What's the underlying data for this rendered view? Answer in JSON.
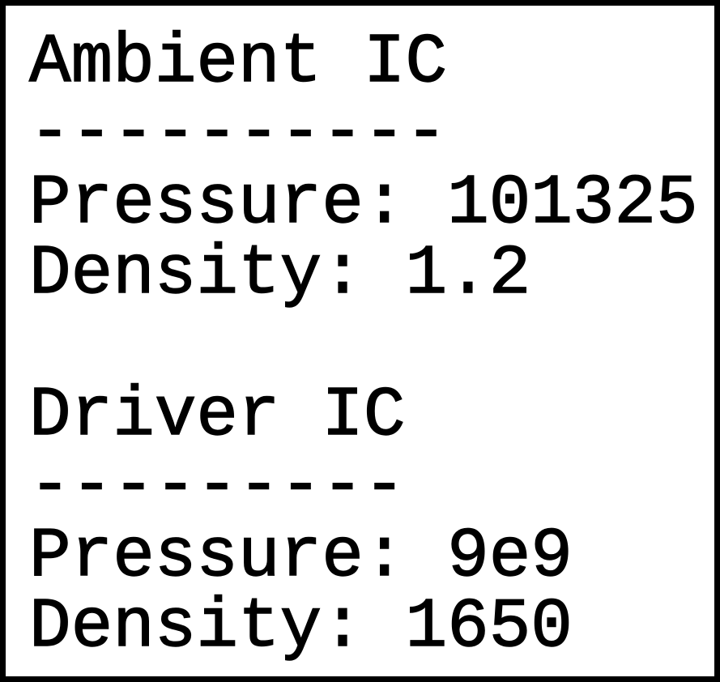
{
  "ambient_ic": {
    "title": "Ambient IC",
    "rule": "----------",
    "pressure": "Pressure: 101325",
    "density": "Density: 1.2"
  },
  "driver_ic": {
    "title": "Driver IC",
    "rule": "---------",
    "pressure": "Pressure: 9e9",
    "density": "Density: 1650"
  }
}
